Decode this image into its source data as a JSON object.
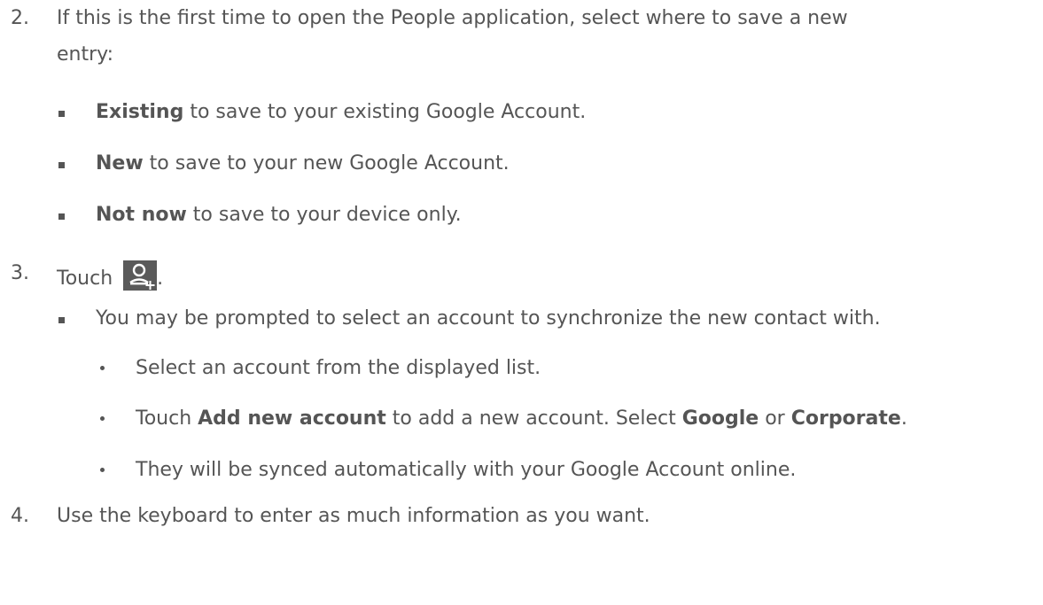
{
  "step2": {
    "number": "2.",
    "line1": "If this is the first time to open the People application, select where to save a new",
    "line2": "entry:",
    "options": [
      {
        "bold": "Existing",
        "rest": " to save to your existing Google Account."
      },
      {
        "bold": "New",
        "rest": " to save to your new Google Account."
      },
      {
        "bold": "Not now",
        "rest": " to save to your device only."
      }
    ]
  },
  "step3": {
    "number": "3.",
    "text": "Touch",
    "after_icon": ".",
    "icon": "add-contact-icon",
    "note": "You may be prompted to select an account to synchronize the new contact with.",
    "sub1": "Select an account from the displayed list.",
    "sub2": {
      "a": "Touch ",
      "b1": "Add new account",
      "c": " to add a new account. Select ",
      "b2": "Google",
      "d": " or ",
      "b3": "Corporate",
      "e": "."
    },
    "sub3": "They will be synced automatically with your Google Account online."
  },
  "step4": {
    "number": "4.",
    "text": "Use the keyboard to enter as much information as you want."
  }
}
